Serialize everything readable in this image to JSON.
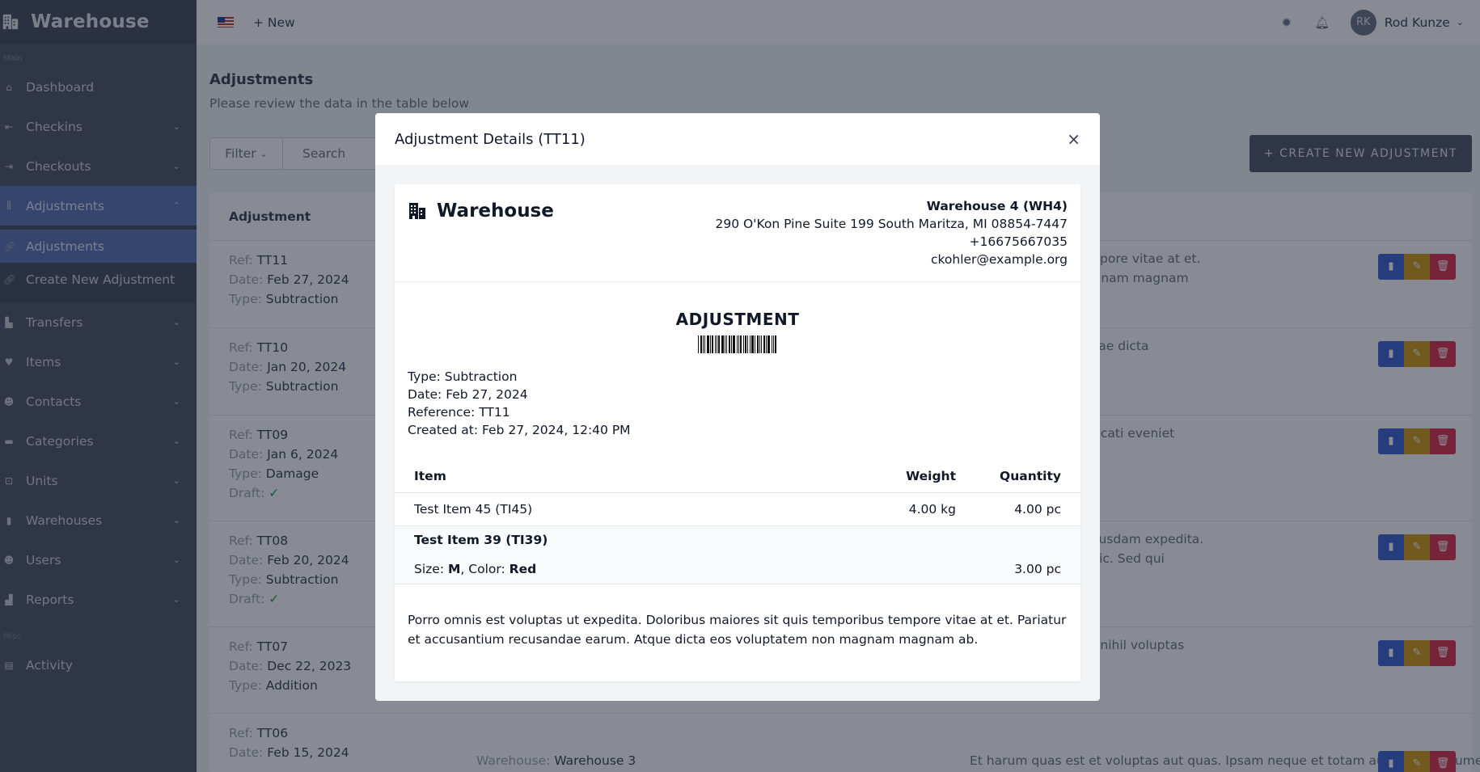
{
  "app": {
    "brand": "Warehouse"
  },
  "sidebar": {
    "section_main": "Main",
    "section_misc": "Misc",
    "items": [
      {
        "label": "Dashboard",
        "icon": "home-icon"
      },
      {
        "label": "Checkins",
        "icon": "checkin-icon"
      },
      {
        "label": "Checkouts",
        "icon": "checkout-icon"
      },
      {
        "label": "Adjustments",
        "icon": "adjustments-icon"
      },
      {
        "label": "Adjustments",
        "icon": "link-icon"
      },
      {
        "label": "Create New Adjustment",
        "icon": "link-icon"
      },
      {
        "label": "Transfers",
        "icon": "truck-icon"
      },
      {
        "label": "Items",
        "icon": "heart-icon"
      },
      {
        "label": "Contacts",
        "icon": "users-icon"
      },
      {
        "label": "Categories",
        "icon": "folder-icon"
      },
      {
        "label": "Units",
        "icon": "unit-icon"
      },
      {
        "label": "Warehouses",
        "icon": "bookmark-icon"
      },
      {
        "label": "Users",
        "icon": "users-icon"
      },
      {
        "label": "Reports",
        "icon": "chart-icon"
      },
      {
        "label": "Activity",
        "icon": "file-icon"
      }
    ]
  },
  "topbar": {
    "new_label": "+ New",
    "user_initials": "RK",
    "user_name": "Rod Kunze"
  },
  "page": {
    "title": "Adjustments",
    "subtitle": "Please review the data in the table below",
    "filter_label": "Filter",
    "search_placeholder": "Search",
    "create_label": "+ CREATE NEW ADJUSTMENT",
    "column_adjustment": "Adjustment",
    "labels": {
      "ref": "Ref:",
      "date": "Date:",
      "type": "Type:",
      "draft": "Draft:",
      "warehouse": "Warehouse:"
    }
  },
  "rows": [
    {
      "ref": "TT11",
      "date": "Feb 27, 2024",
      "type": "Subtraction",
      "draft": false,
      "note1": "quis temporibus tempore vitae at et.",
      "note2": "voluptatem non magnam magnam ab."
    },
    {
      "ref": "TT10",
      "date": "Jan 20, 2024",
      "type": "Subtraction",
      "draft": false,
      "note1": "cta omnis repudiandae dicta excepturi",
      "note2": ""
    },
    {
      "ref": "TT09",
      "date": "Jan 6, 2024",
      "type": "Damage",
      "draft": true,
      "note1": "m sed. Debitis occaecati eveniet error",
      "note2": ""
    },
    {
      "ref": "TT08",
      "date": "Feb 20, 2024",
      "type": "Subtraction",
      "draft": true,
      "note1": "tur omnis sit sit quibusdam expedita.",
      "note2": "um voluptas quam hic. Sed qui quisquam"
    },
    {
      "ref": "TT07",
      "date": "Dec 22, 2023",
      "type": "Addition",
      "draft": false,
      "note1": "edita molestiae. Aut nihil voluptas dicta",
      "note2": ""
    },
    {
      "ref": "TT06",
      "date": "Feb 15, 2024",
      "type": "",
      "draft": false,
      "warehouse": "Warehouse 3",
      "note1": "Et harum quas est et voluptas aut quas. Ipsam neque et totam autem. Et assumenda sit eligendi",
      "note2": ""
    }
  ],
  "modal": {
    "title": "Adjustment Details (TT11)",
    "brand": "Warehouse",
    "warehouse_name": "Warehouse 4 (WH4)",
    "address": "290 O'Kon Pine Suite 199 South Maritza, MI 08854-7447",
    "phone": "+16675667035",
    "email": "ckohler@example.org",
    "heading": "ADJUSTMENT",
    "meta": {
      "type": "Type: Subtraction",
      "date": "Date: Feb 27, 2024",
      "reference": "Reference: TT11",
      "created": "Created at: Feb 27, 2024, 12:40 PM"
    },
    "table": {
      "col_item": "Item",
      "col_weight": "Weight",
      "col_quantity": "Quantity",
      "rows": [
        {
          "item": "Test Item 45 (TI45)",
          "weight": "4.00 kg",
          "quantity": "4.00 pc"
        },
        {
          "item": "Test Item 39 (TI39)",
          "size_label": "Size:",
          "size": "M",
          "color_label": ", Color:",
          "color": "Red",
          "quantity": "3.00 pc"
        }
      ]
    },
    "details": "Porro omnis est voluptas ut expedita. Doloribus maiores sit quis temporibus tempore vitae at et. Pariatur et accusantium recusandae earum. Atque dicta eos voluptatem non magnam magnam ab."
  },
  "colors": {
    "sidebar": "#4b5567",
    "active": "#5a72b5",
    "view": "#3b63d3",
    "edit": "#d39a12",
    "delete": "#dc2f4a"
  }
}
